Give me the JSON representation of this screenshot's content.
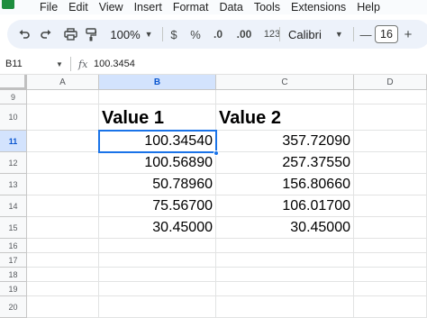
{
  "menu": {
    "items": [
      "File",
      "Edit",
      "View",
      "Insert",
      "Format",
      "Data",
      "Tools",
      "Extensions",
      "Help"
    ]
  },
  "toolbar": {
    "zoom": "100%",
    "currency_symbol": "$",
    "percent_symbol": "%",
    "decrease_decimals": ".0",
    "increase_decimals": ".00",
    "number_format": "123",
    "font_name": "Calibri",
    "font_size": "16",
    "decrease_font": "—",
    "increase_font": "+",
    "icons": [
      "undo-icon",
      "redo-icon",
      "print-icon",
      "paint-format-icon",
      "caret-down-icon",
      "minus-icon",
      "plus-icon"
    ]
  },
  "formula_bar": {
    "name_box": "B11",
    "fx_label": "fx",
    "value": "100.3454"
  },
  "sheet": {
    "columns": [
      "A",
      "B",
      "C",
      "D"
    ],
    "rows": [
      "9",
      "10",
      "11",
      "12",
      "13",
      "14",
      "15",
      "16",
      "17",
      "18",
      "19",
      "20"
    ],
    "selected_column": "B",
    "selected_row": "11",
    "active_cell": "B11",
    "header_row": {
      "b": "Value 1",
      "c": "Value 2"
    },
    "values": [
      {
        "b": "100.34540",
        "c": "357.72090"
      },
      {
        "b": "100.56890",
        "c": "257.37550"
      },
      {
        "b": "50.78960",
        "c": "156.80660"
      },
      {
        "b": "75.56700",
        "c": "106.01700"
      },
      {
        "b": "30.45000",
        "c": "30.45000"
      }
    ],
    "accent_color": "#1a73e8",
    "selected_header_color": "#d3e3fd"
  }
}
